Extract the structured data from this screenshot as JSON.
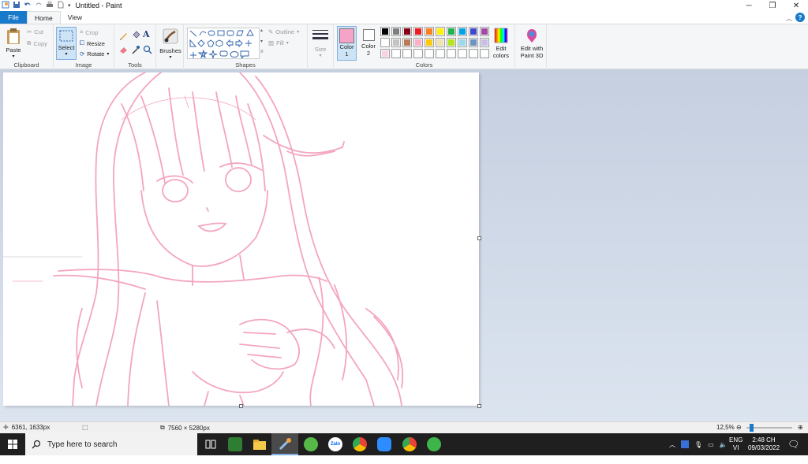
{
  "window": {
    "title": "Untitled - Paint",
    "controls": [
      "minimize",
      "restore",
      "close"
    ]
  },
  "tabs": [
    "File",
    "Home",
    "View"
  ],
  "ribbon": {
    "clipboard": {
      "paste": "Paste",
      "cut": "Cut",
      "copy": "Copy",
      "label": "Clipboard"
    },
    "image": {
      "select": "Select",
      "crop": "Crop",
      "resize": "Resize",
      "rotate": "Rotate",
      "label": "Image"
    },
    "tools": {
      "label": "Tools"
    },
    "brushes": {
      "label": "Brushes"
    },
    "shapes": {
      "outline": "Outline",
      "fill": "Fill",
      "label": "Shapes"
    },
    "size": {
      "label": "Size"
    },
    "colors": {
      "color1": "Color 1",
      "color2": "Color 2",
      "edit_colors": "Edit colors",
      "edit_3d": "Edit with Paint 3D",
      "label": "Colors",
      "color1_value": "#f5a3c7",
      "color2_value": "#ffffff",
      "palette_row1": [
        "#000000",
        "#7f7f7f",
        "#880015",
        "#ed1c24",
        "#ff7f27",
        "#fff200",
        "#22b14c",
        "#00a2e8",
        "#3f48cc",
        "#a349a4"
      ],
      "palette_row2": [
        "#ffffff",
        "#c3c3c3",
        "#b97a57",
        "#ffaec9",
        "#ffc90e",
        "#efe4b0",
        "#b5e61d",
        "#99d9ea",
        "#7092be",
        "#c8bfe7"
      ],
      "palette_row3": [
        "#f9d3e2",
        "#ffffff",
        "#ffffff",
        "#ffffff",
        "#ffffff",
        "#ffffff",
        "#ffffff",
        "#ffffff",
        "#ffffff",
        "#ffffff"
      ]
    }
  },
  "status": {
    "cursor": "6361, 1633px",
    "image_size": "7560 × 5280px",
    "zoom": "12,5%"
  },
  "taskbar": {
    "search_placeholder": "Type here to search",
    "lang": "ENG",
    "lang2": "VI",
    "time": "2:48 CH",
    "date": "09/03/2022",
    "apps": [
      "task-view",
      "game-app",
      "file-explorer",
      "paint",
      "greenshot",
      "zalo",
      "chrome",
      "zoom",
      "chrome-profile",
      "other-app"
    ]
  }
}
